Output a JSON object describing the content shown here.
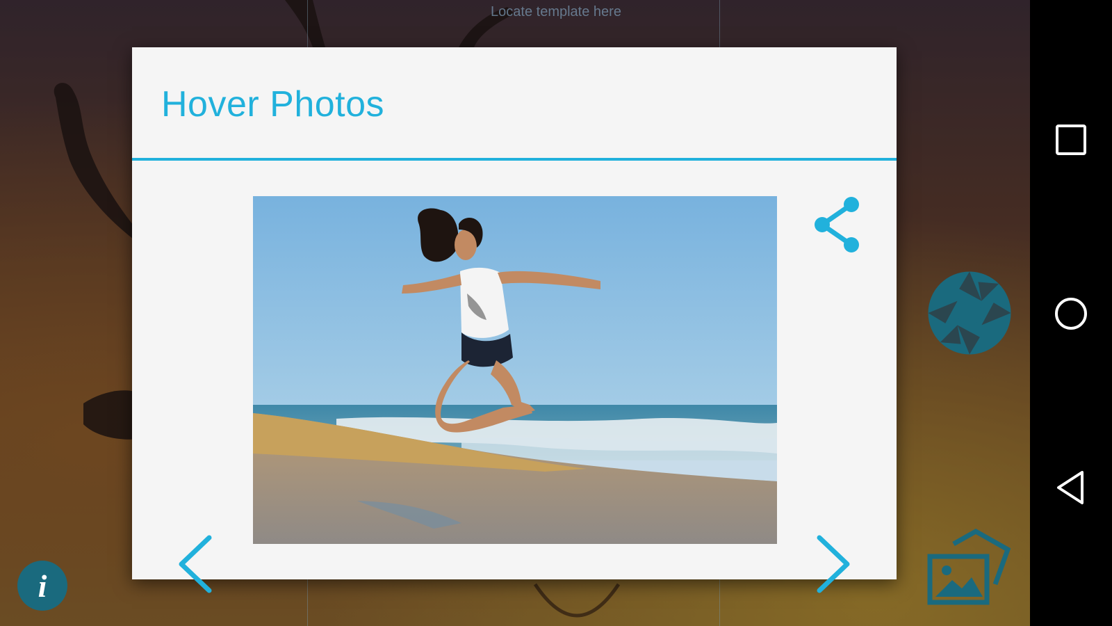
{
  "camera": {
    "hint": "Locate template here"
  },
  "dialog": {
    "title": "Hover Photos",
    "photo_description": "Woman in white tank top jumping on a sunny beach with waves and blue sky"
  },
  "controls": {
    "info_glyph": "i"
  },
  "icons": {
    "share": "share-icon",
    "previous": "chevron-left-icon",
    "next": "chevron-right-icon",
    "shutter": "camera-shutter-icon",
    "gallery": "gallery-icon",
    "info": "info-icon",
    "recents": "square-icon",
    "home": "circle-icon",
    "back": "triangle-back-icon"
  },
  "colors": {
    "accent": "#21b1dc",
    "dialog_bg": "#f5f5f5",
    "nav_bar": "#000000",
    "camera_controls": "#1a6a7e"
  }
}
